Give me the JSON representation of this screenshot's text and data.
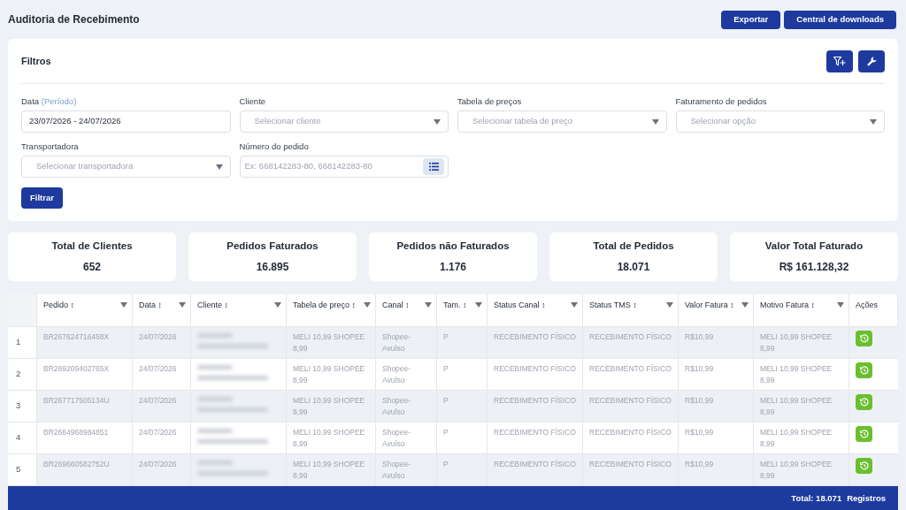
{
  "page_title": "Auditoria de Recebimento",
  "header_buttons": [
    "Exportar",
    "Central de downloads"
  ],
  "filters": {
    "title": "Filtros",
    "fields": [
      {
        "kind": "input",
        "label": "Data",
        "label_hint": "(Período)",
        "value": "23/07/2026 - 24/07/2026"
      },
      {
        "kind": "select",
        "label": "Cliente",
        "placeholder": "Selecionar cliente"
      },
      {
        "kind": "select",
        "label": "Tabela de preços",
        "placeholder": "Selecionar tabela de preço"
      },
      {
        "kind": "select",
        "label": "Faturamento de pedidos",
        "placeholder": "Selecionar opção"
      },
      {
        "kind": "select",
        "label": "Transportadora",
        "placeholder": "Selecionar transportadora"
      },
      {
        "kind": "list_input",
        "label": "Número do pedido",
        "placeholder": "Ex: 668142283-80, 668142283-80"
      }
    ],
    "submit": "Filtrar"
  },
  "stats": [
    {
      "label": "Total de Clientes",
      "value": "652"
    },
    {
      "label": "Pedidos Faturados",
      "value": "16.895"
    },
    {
      "label": "Pedidos não Faturados",
      "value": "1.176"
    },
    {
      "label": "Total de Pedidos",
      "value": "18.071"
    },
    {
      "label": "Valor Total Faturado",
      "value": "R$ 161.128,32"
    }
  ],
  "table": {
    "columns": [
      {
        "label": "Pedido ↕",
        "filter": true
      },
      {
        "label": "Data ↕",
        "filter": true
      },
      {
        "label": "Cliente ↕",
        "filter": true
      },
      {
        "label": "Tabela de preço ↕",
        "filter": true
      },
      {
        "label": "Canal ↕",
        "filter": true
      },
      {
        "label": "Tam. ↕",
        "filter": true
      },
      {
        "label": "Status Canal ↕",
        "filter": true
      },
      {
        "label": "Status TMS ↕",
        "filter": true
      },
      {
        "label": "Valor Fatura ↕",
        "filter": true
      },
      {
        "label": "Motivo Fatura ↕",
        "filter": true
      },
      {
        "label": "Ações",
        "filter": false
      }
    ],
    "rows": [
      {
        "index": "1",
        "cells": [
          "BR267624716458X",
          "24/07/2026",
          null,
          "MELI 10,99 SHOPEE 8,99",
          "Shopee-Avulso",
          "P",
          "RECEBIMENTO FÍSICO",
          "RECEBIMENTO FÍSICO",
          "R$10,99",
          "MELI 10,99 SHOPEE 8,99"
        ]
      },
      {
        "index": "2",
        "cells": [
          "BR269209402765X",
          "24/07/2026",
          null,
          "MELI 10,99 SHOPEE 8,99",
          "Shopee-Avulso",
          "P",
          "RECEBIMENTO FÍSICO",
          "RECEBIMENTO FÍSICO",
          "R$10,99",
          "MELI 10,99 SHOPEE 8,99"
        ]
      },
      {
        "index": "3",
        "cells": [
          "BR267717505134U",
          "24/07/2026",
          null,
          "MELI 10,99 SHOPEE 8,99",
          "Shopee-Avulso",
          "P",
          "RECEBIMENTO FÍSICO",
          "RECEBIMENTO FÍSICO",
          "R$10,99",
          "MELI 10,99 SHOPEE 8,99"
        ]
      },
      {
        "index": "4",
        "cells": [
          "BR2664968984851",
          "24/07/2026",
          null,
          "MELI 10,99 SHOPEE 8,99",
          "Shopee-Avulso",
          "P",
          "RECEBIMENTO FÍSICO",
          "RECEBIMENTO FÍSICO",
          "R$10,99",
          "MELI 10,99 SHOPEE 8,99"
        ]
      },
      {
        "index": "5",
        "cells": [
          "BR269660582752U",
          "24/07/2026",
          null,
          "MELI 10,99 SHOPEE 8,99",
          "Shopee-Avulso",
          "P",
          "RECEBIMENTO FÍSICO",
          "RECEBIMENTO FÍSICO",
          "R$10,99",
          "MELI 10,99 SHOPEE 8,99"
        ]
      }
    ],
    "footer": {
      "total": "Total: 18.071",
      "unit": "Registros"
    }
  }
}
